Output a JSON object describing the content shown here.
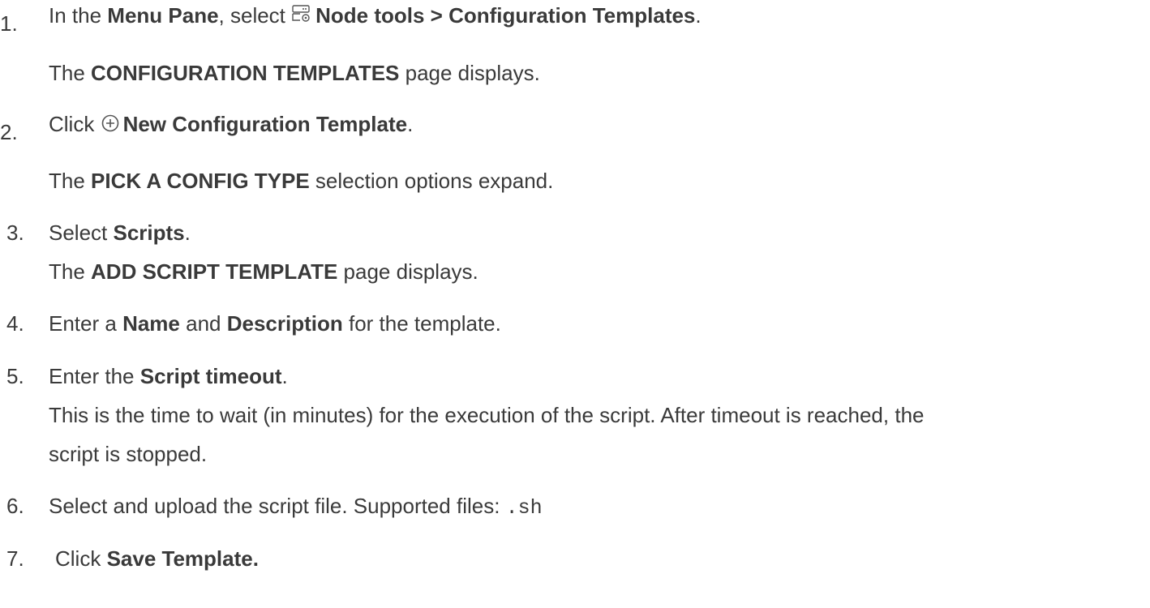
{
  "steps": [
    {
      "number": "1.",
      "line": {
        "pre": "In the ",
        "b1": "Menu Pane",
        "mid": ", select ",
        "icon": "server-gear-icon",
        "b2": "Node tools > Configuration Templates",
        "post": "."
      },
      "result": {
        "pre": "The ",
        "b": "CONFIGURATION TEMPLATES",
        "post": " page displays."
      }
    },
    {
      "number": "2.",
      "line": {
        "pre": "Click ",
        "icon": "plus-circle-icon",
        "b": "New Configuration Template",
        "post": "."
      },
      "result": {
        "pre": "The ",
        "b": "PICK A CONFIG TYPE",
        "post": " selection options expand."
      }
    },
    {
      "number": "3.",
      "line": {
        "pre": "Select ",
        "b": "Scripts",
        "post": "."
      },
      "result": {
        "pre": "The ",
        "b": "ADD SCRIPT TEMPLATE",
        "post": " page displays."
      }
    },
    {
      "number": "4.",
      "line": {
        "pre": "Enter a ",
        "b1": "Name",
        "mid": " and ",
        "b2": "Description",
        "post": " for the template."
      }
    },
    {
      "number": "5.",
      "line": {
        "pre": "Enter the ",
        "b": "Script timeout",
        "post": "."
      },
      "desc1": "This is the time to wait (in minutes) for the execution of the script. After timeout is reached, the",
      "desc2": "script is stopped."
    },
    {
      "number": "6.",
      "line": {
        "pre": "Select and upload the script file. Supported files: ",
        "code": ".sh"
      }
    },
    {
      "number": "7.",
      "line": {
        "pre": "Click ",
        "b": "Save Template."
      }
    }
  ]
}
